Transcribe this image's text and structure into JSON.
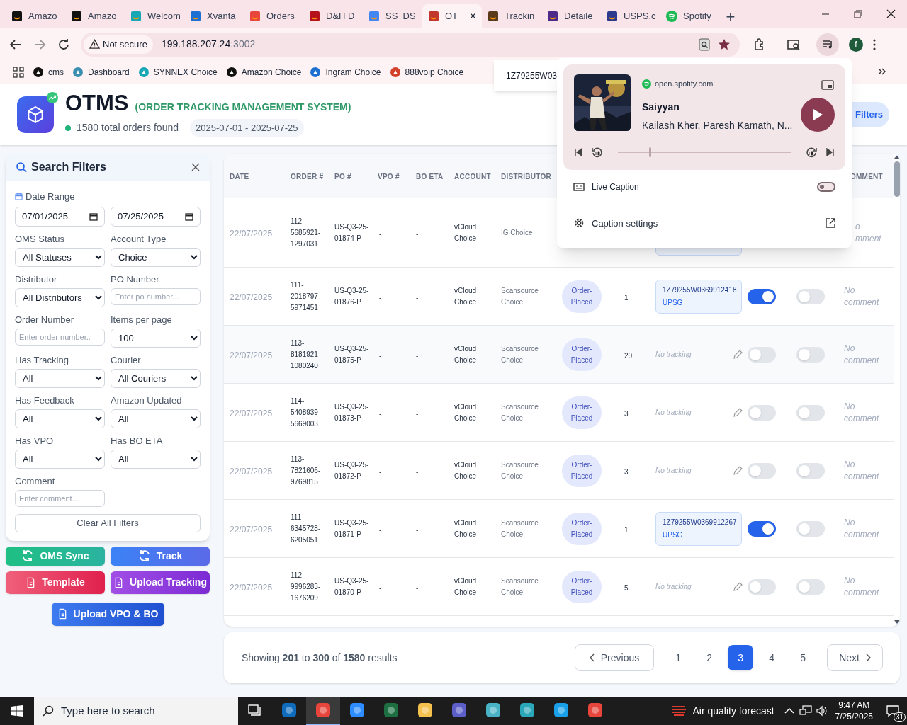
{
  "browser": {
    "tabs": [
      {
        "title": "Amazo",
        "selected": false
      },
      {
        "title": "Amazo",
        "selected": false
      },
      {
        "title": "Welcom",
        "selected": false
      },
      {
        "title": "Xvanta",
        "selected": false
      },
      {
        "title": "Orders",
        "selected": false
      },
      {
        "title": "D&H D",
        "selected": false
      },
      {
        "title": "SS_DS_",
        "selected": false
      },
      {
        "title": "OT",
        "selected": true
      },
      {
        "title": "Trackin",
        "selected": false
      },
      {
        "title": "Detaile",
        "selected": false
      },
      {
        "title": "USPS.c",
        "selected": false
      },
      {
        "title": "Spotify",
        "selected": false
      }
    ],
    "new_tab": "+",
    "close_tab": "×",
    "security": "Not secure",
    "url_host": "199.188.207.24",
    "url_port": ":3002",
    "profile": "f",
    "bookmarks": [
      "cms",
      "Dashboard",
      "SYNNEX Choice",
      "Amazon Choice",
      "Ingram Choice",
      "888voip Choice"
    ],
    "hover_tooltip": "1Z79255W03"
  },
  "header": {
    "title": "OTMS",
    "subtitle": "(ORDER TRACKING MANAGEMENT SYSTEM)",
    "count": "1580 total orders found",
    "date_chip": "2025-07-01 - 2025-07-25",
    "filters_button": "Filters"
  },
  "filters": {
    "title": "Search Filters",
    "date_label": "Date Range",
    "date_from": "07/01/2025",
    "date_to": "07/25/2025",
    "fields": [
      {
        "label": "OMS Status",
        "kind": "select",
        "value": "All Statuses"
      },
      {
        "label": "Account Type",
        "kind": "select",
        "value": "Choice"
      },
      {
        "label": "Distributor",
        "kind": "select",
        "value": "All Distributors"
      },
      {
        "label": "PO Number",
        "kind": "input",
        "placeholder": "Enter po number..."
      },
      {
        "label": "Order Number",
        "kind": "input",
        "placeholder": "Enter order number.."
      },
      {
        "label": "Items per page",
        "kind": "select",
        "value": "100"
      },
      {
        "label": "Has Tracking",
        "kind": "select",
        "value": "All"
      },
      {
        "label": "Courier",
        "kind": "select",
        "value": "All Couriers"
      },
      {
        "label": "Has Feedback",
        "kind": "select",
        "value": "All"
      },
      {
        "label": "Amazon Updated",
        "kind": "select",
        "value": "All"
      },
      {
        "label": "Has VPO",
        "kind": "select",
        "value": "All"
      },
      {
        "label": "Has BO ETA",
        "kind": "select",
        "value": "All"
      },
      {
        "label": "Comment",
        "kind": "input",
        "placeholder": "Enter comment..."
      }
    ],
    "clear_button": "Clear All Filters"
  },
  "actions": [
    {
      "label": "OMS Sync",
      "kind": "sync"
    },
    {
      "label": "Track",
      "kind": "track"
    },
    {
      "label": "Template",
      "kind": "template"
    },
    {
      "label": "Upload Tracking",
      "kind": "upload"
    },
    {
      "label": "Upload VPO & BO",
      "kind": "vpo"
    }
  ],
  "table": {
    "columns": [
      "DATE",
      "ORDER #",
      "PO #",
      "VPO #",
      "BO ETA",
      "ACCOUNT",
      "DISTRIBUTOR"
    ],
    "column_13": "OMMENT",
    "rows": [
      {
        "date": "22/07/2025",
        "order": "112-5685921-1297031",
        "po": "US-Q3-25-01874-P",
        "vpo": "-",
        "bo_eta": "-",
        "account": "vCloud Choice",
        "distributor": "IG Choice",
        "tracking": {
          "kind": "covered"
        },
        "comment": "o mment"
      },
      {
        "date": "22/07/2025",
        "order": "111-2018797-5971451",
        "po": "US-Q3-25-01876-P",
        "vpo": "-",
        "bo_eta": "-",
        "account": "vCloud Choice",
        "distributor": "Scansource Choice",
        "status": "Order-Placed",
        "qty": "1",
        "tracking": {
          "kind": "box",
          "number": "1Z79255W0369912418",
          "carrier": "UPSG"
        },
        "toggle_1": true,
        "toggle_2": false,
        "comment": "No comment"
      },
      {
        "date": "22/07/2025",
        "order": "113-8181921-1080240",
        "po": "US-Q3-25-01875-P",
        "vpo": "-",
        "bo_eta": "-",
        "account": "vCloud Choice",
        "distributor": "Scansource Choice",
        "status": "Order-Placed",
        "qty": "20",
        "tracking": {
          "kind": "none",
          "text": "No tracking"
        },
        "toggle_1": false,
        "toggle_2": false,
        "comment": "No comment"
      },
      {
        "date": "22/07/2025",
        "order": "114-5408939-5669003",
        "po": "US-Q3-25-01873-P",
        "vpo": "-",
        "bo_eta": "-",
        "account": "vCloud Choice",
        "distributor": "Scansource Choice",
        "status": "Order-Placed",
        "qty": "3",
        "tracking": {
          "kind": "none",
          "text": "No tracking"
        },
        "toggle_1": false,
        "toggle_2": false,
        "comment": "No comment"
      },
      {
        "date": "22/07/2025",
        "order": "113-7821606-9769815",
        "po": "US-Q3-25-01872-P",
        "vpo": "-",
        "bo_eta": "-",
        "account": "vCloud Choice",
        "distributor": "Scansource Choice",
        "status": "Order-Placed",
        "qty": "3",
        "tracking": {
          "kind": "none",
          "text": "No tracking"
        },
        "toggle_1": false,
        "toggle_2": false,
        "comment": "No comment"
      },
      {
        "date": "22/07/2025",
        "order": "111-6345728-6205051",
        "po": "US-Q3-25-01871-P",
        "vpo": "-",
        "bo_eta": "-",
        "account": "vCloud Choice",
        "distributor": "Scansource Choice",
        "status": "Order-Placed",
        "qty": "1",
        "tracking": {
          "kind": "box",
          "number": "1Z79255W0369912267",
          "carrier": "UPSG"
        },
        "toggle_1": true,
        "toggle_2": false,
        "comment": "No comment"
      },
      {
        "date": "22/07/2025",
        "order": "112-9996283-1676209",
        "po": "US-Q3-25-01870-P",
        "vpo": "-",
        "bo_eta": "-",
        "account": "vCloud Choice",
        "distributor": "Scansource Choice",
        "status": "Order-Placed",
        "qty": "5",
        "tracking": {
          "kind": "none",
          "text": "No tracking"
        },
        "toggle_1": false,
        "toggle_2": false,
        "comment": "No comment"
      }
    ]
  },
  "pagination": {
    "summary": "Showing **201** to **300** of **1580** results",
    "previous": "Previous",
    "next": "Next",
    "pages": [
      {
        "label": "1",
        "selected": false
      },
      {
        "label": "2",
        "selected": false
      },
      {
        "label": "3",
        "selected": true
      },
      {
        "label": "4",
        "selected": false
      },
      {
        "label": "5",
        "selected": false
      }
    ]
  },
  "media_popup": {
    "source": "open.spotify.com",
    "track": "Saiyyan",
    "artists": "Kailash Kher, Paresh Kamath, N...",
    "level": 0.18,
    "live_caption": "Live Caption",
    "live_caption_on": false,
    "caption_settings": "Caption settings"
  },
  "taskbar": {
    "search_placeholder": "Type here to search",
    "weather": "Air quality forecast",
    "time": "9:47 AM",
    "date": "7/25/2025",
    "notifications": "31"
  }
}
